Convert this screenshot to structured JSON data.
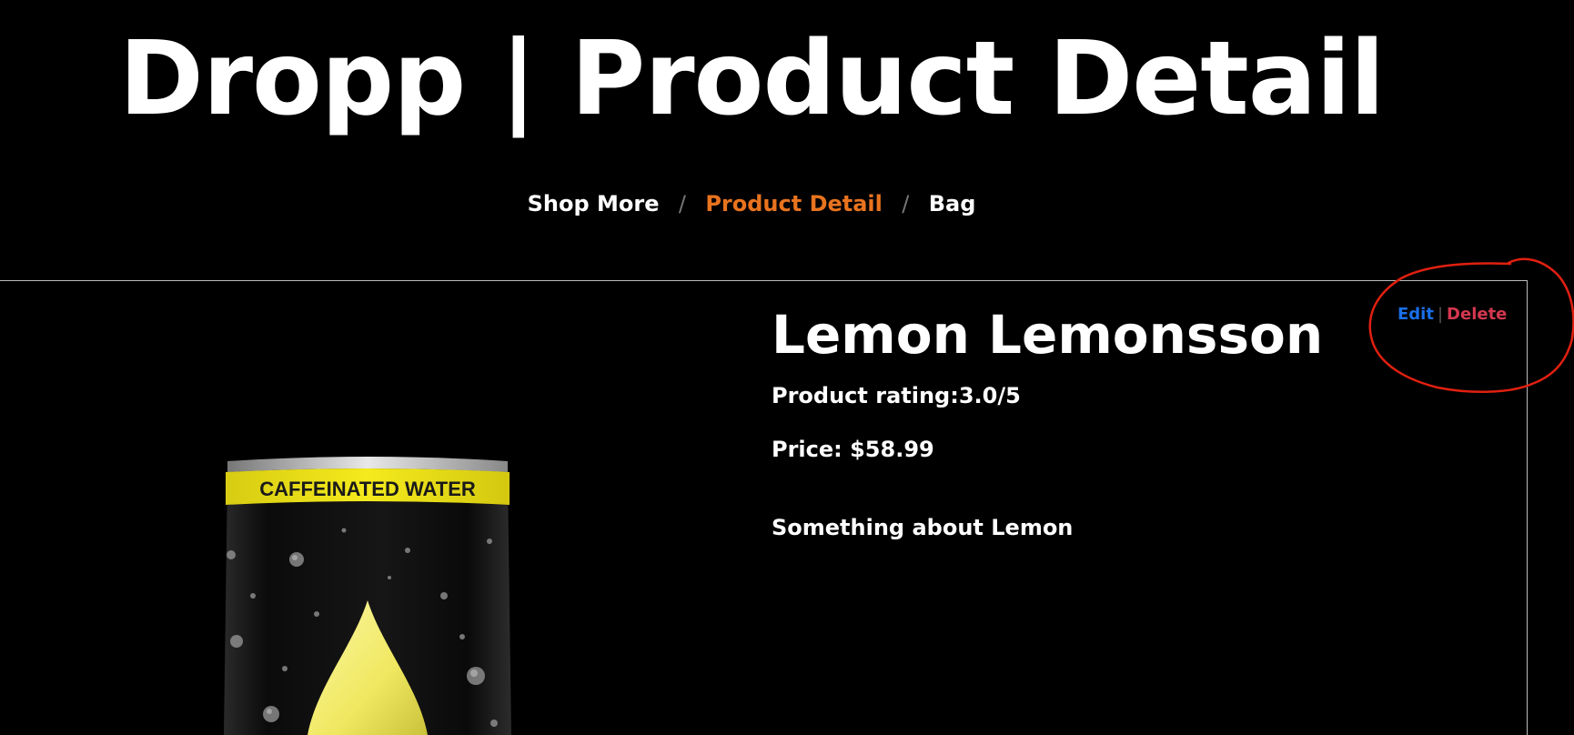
{
  "page": {
    "title": "Dropp | Product Detail"
  },
  "breadcrumb": {
    "items": [
      {
        "label": "Shop More"
      },
      {
        "label": "Product Detail"
      },
      {
        "label": "Bag"
      }
    ],
    "separator": "/"
  },
  "product": {
    "name": "Lemon Lemonsson",
    "rating": "Product rating:3.0/5",
    "price": "Price: $58.99",
    "description": "Something about Lemon",
    "image": {
      "can_band_text": "CAFFEINATED WATER",
      "band_color": "#f2e516",
      "can_color": "#111111",
      "drop_color": "#f2ec6a"
    }
  },
  "actions": {
    "edit_label": "Edit",
    "separator": "|",
    "delete_label": "Delete"
  },
  "colors": {
    "background": "#000000",
    "text": "#ffffff",
    "breadcrumb_active": "#e8731e",
    "edit": "#1a6fe8",
    "delete": "#d4384f",
    "annotation": "#e02010"
  }
}
